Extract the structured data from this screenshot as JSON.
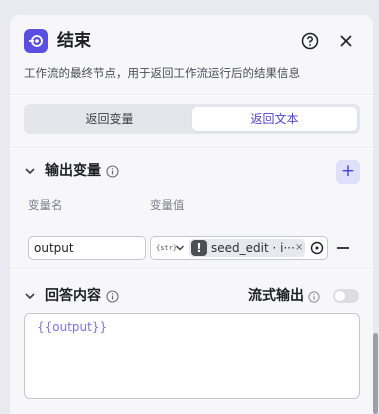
{
  "header": {
    "title": "结束",
    "description": "工作流的最终节点，用于返回工作流运行后的结果信息"
  },
  "tabs": [
    {
      "label": "返回变量",
      "active": false
    },
    {
      "label": "返回文本",
      "active": true
    }
  ],
  "output_section": {
    "title": "输出变量",
    "add_label": "+",
    "columns": {
      "name": "变量名",
      "value": "变量值"
    },
    "row": {
      "name": "output",
      "type_icon": "{str}",
      "reference": "seed_edit · i···",
      "reference_icon": "!",
      "reference_remove": "×"
    }
  },
  "answer_section": {
    "title": "回答内容",
    "stream_label": "流式输出",
    "stream_enabled": false,
    "content": "{{output}}"
  },
  "colors": {
    "accent": "#4c43d6",
    "icon_bg": "#5a4fe0",
    "placeholder_purple": "#7f72e6"
  }
}
